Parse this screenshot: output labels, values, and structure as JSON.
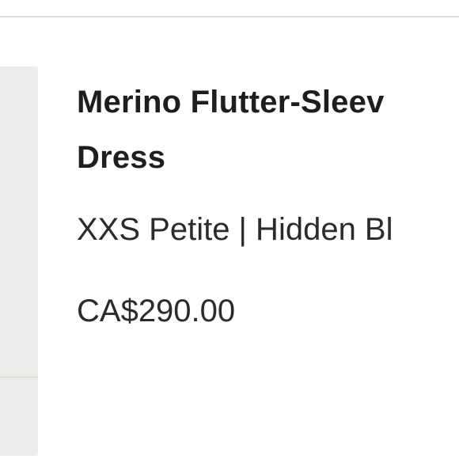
{
  "product": {
    "name_line1": "Merino Flutter-Sleev",
    "name_line2": "Dress",
    "variant": "XXS Petite | Hidden Bl",
    "price": "CA$290.00"
  }
}
